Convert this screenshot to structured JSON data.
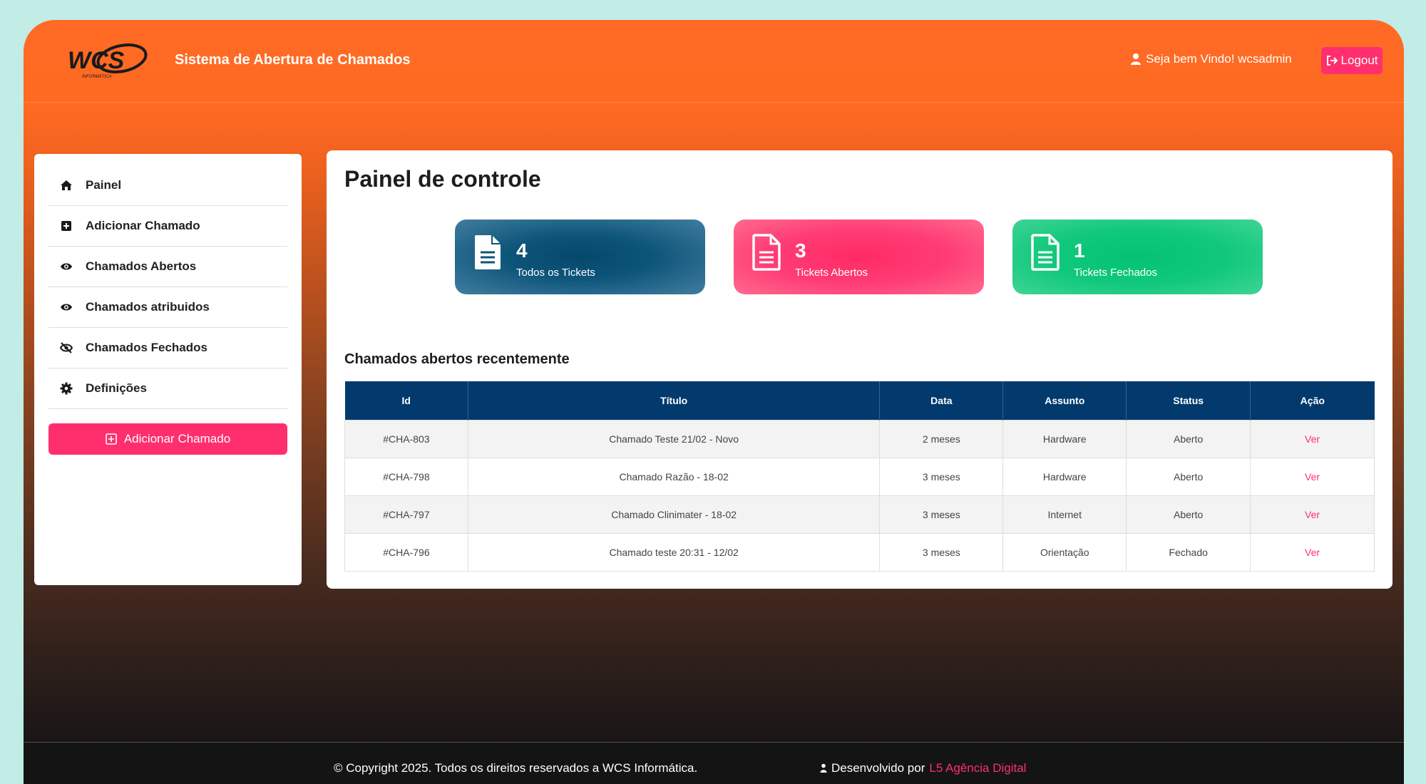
{
  "header": {
    "logo_text": "WCS",
    "logo_subtext": "INFORMÁTICA",
    "app_title": "Sistema de Abertura de Chamados",
    "welcome": "Seja bem Vindo! wcsadmin",
    "logout_label": "Logout"
  },
  "sidebar": {
    "items": [
      {
        "label": "Painel",
        "icon": "home-icon"
      },
      {
        "label": "Adicionar Chamado",
        "icon": "plus-square-icon"
      },
      {
        "label": "Chamados Abertos",
        "icon": "eye-icon"
      },
      {
        "label": "Chamados atribuidos",
        "icon": "eye-icon"
      },
      {
        "label": "Chamados Fechados",
        "icon": "eye-slash-icon"
      },
      {
        "label": "Definições",
        "icon": "gear-icon"
      }
    ],
    "button_label": "Adicionar Chamado"
  },
  "main": {
    "title": "Painel de controle",
    "cards": [
      {
        "value": "4",
        "label": "Todos os Tickets",
        "color": "#05486c"
      },
      {
        "value": "3",
        "label": "Tickets Abertos",
        "color": "#ff2a66"
      },
      {
        "value": "1",
        "label": "Tickets Fechados",
        "color": "#04c271"
      }
    ],
    "section_title": "Chamados abertos recentemente",
    "table": {
      "headers": [
        "Id",
        "Título",
        "Data",
        "Assunto",
        "Status",
        "Ação"
      ],
      "rows": [
        [
          "#CHA-803",
          "Chamado Teste 21/02 - Novo",
          "2 meses",
          "Hardware",
          "Aberto",
          "Ver"
        ],
        [
          "#CHA-798",
          "Chamado Razão - 18-02",
          "3 meses",
          "Hardware",
          "Aberto",
          "Ver"
        ],
        [
          "#CHA-797",
          "Chamado Clinimater - 18-02",
          "3 meses",
          "Internet",
          "Aberto",
          "Ver"
        ],
        [
          "#CHA-796",
          "Chamado teste 20:31 - 12/02",
          "3 meses",
          "Orientação",
          "Fechado",
          "Ver"
        ]
      ]
    }
  },
  "footer": {
    "copyright": "© Copyright 2025. Todos os direitos reservados a WCS Informática.",
    "dev_prefix": "Desenvolvido por",
    "dev_link": "L5 Agência Digital"
  },
  "colors": {
    "accent": "#ff2f6d",
    "header": "#ff6b25",
    "table_header": "#023a6d"
  }
}
